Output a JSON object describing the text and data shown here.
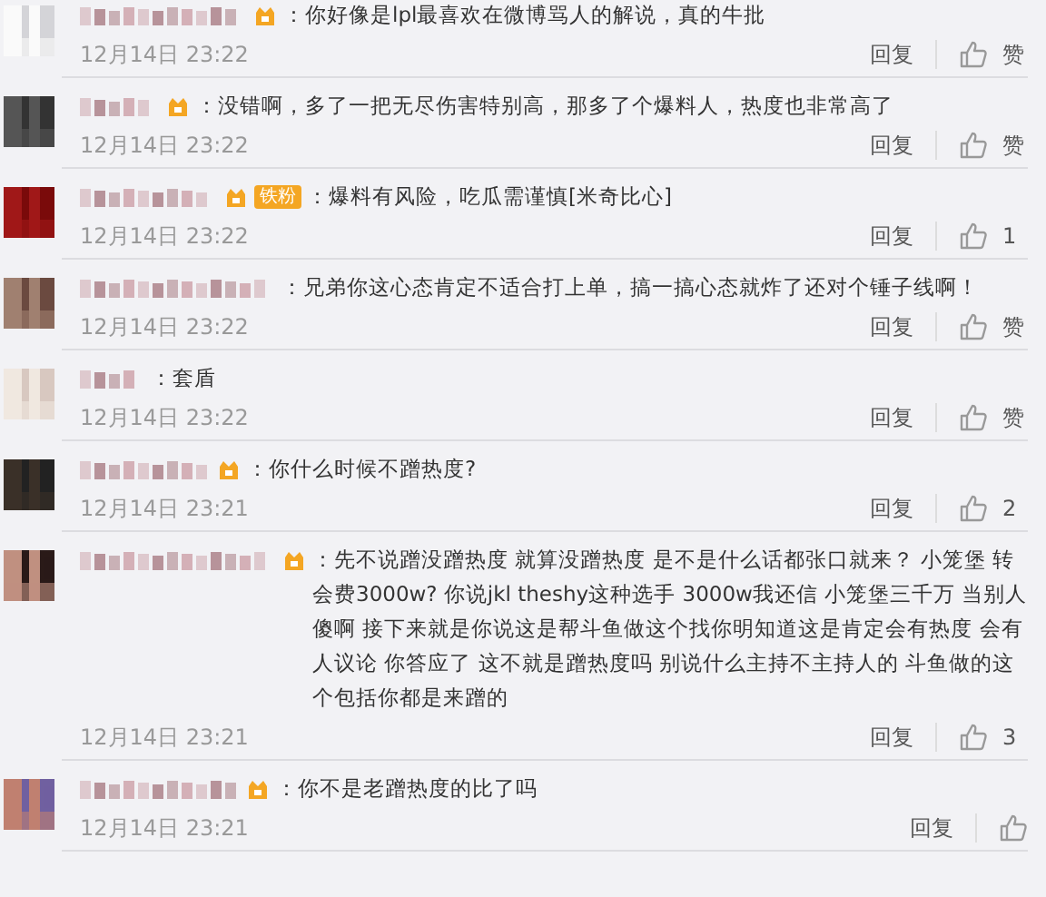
{
  "comments": [
    {
      "vip": true,
      "text": "：你好像是lpl最喜欢在微博骂人的解说，真的牛批",
      "time": "12月14日 23:22",
      "reply": "回复",
      "likes": "赞"
    },
    {
      "vip": true,
      "text": "：没错啊，多了一把无尽伤害特别高，那多了个爆料人，热度也非常高了",
      "time": "12月14日 23:22",
      "reply": "回复",
      "likes": "赞"
    },
    {
      "vip": true,
      "fan_badge": "铁粉",
      "text": "：爆料有风险，吃瓜需谨慎[米奇比心]",
      "time": "12月14日 23:22",
      "reply": "回复",
      "likes": "1"
    },
    {
      "vip": false,
      "text": "：兄弟你这心态肯定不适合打上单，搞一搞心态就炸了还对个锤子线啊！",
      "time": "12月14日 23:22",
      "reply": "回复",
      "likes": "赞"
    },
    {
      "vip": false,
      "text": "：套盾",
      "time": "12月14日 23:22",
      "reply": "回复",
      "likes": "赞"
    },
    {
      "vip": true,
      "text": "：你什么时候不蹭热度?",
      "time": "12月14日 23:21",
      "reply": "回复",
      "likes": "2"
    },
    {
      "vip": true,
      "text": "：先不说蹭没蹭热度 就算没蹭热度 是不是什么话都张口就来？ 小笼堡 转会费3000w? 你说jkl theshy这种选手 3000w我还信 小笼堡三千万 当别人傻啊 接下来就是你说这是帮斗鱼做这个找你明知道这是肯定会有热度 会有人议论 你答应了 这不就是蹭热度吗 别说什么主持不主持人的 斗鱼做的这个包括你都是来蹭的",
      "time": "12月14日 23:21",
      "reply": "回复",
      "likes": "3"
    },
    {
      "vip": true,
      "text": "：你不是老蹭热度的比了吗",
      "time": "12月14日 23:21",
      "reply": "回复"
    }
  ]
}
